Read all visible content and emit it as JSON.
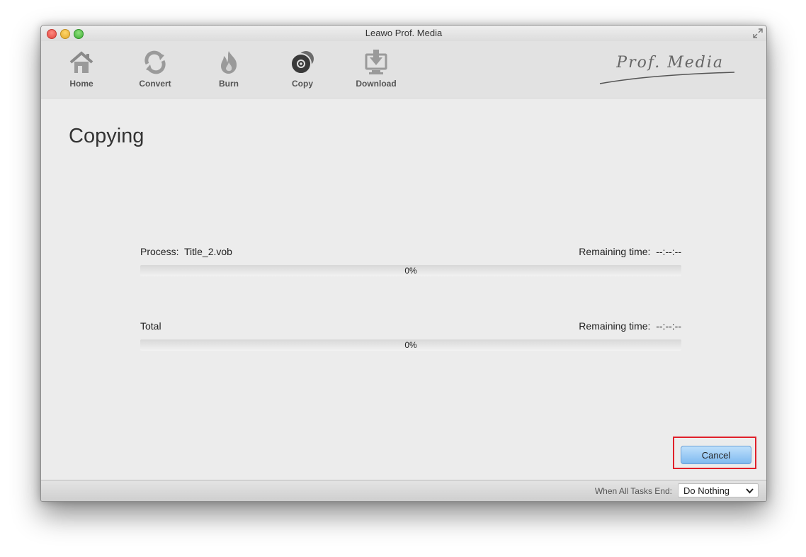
{
  "window": {
    "title": "Leawo Prof. Media"
  },
  "toolbar": {
    "items": [
      {
        "label": "Home",
        "icon": "home-icon"
      },
      {
        "label": "Convert",
        "icon": "convert-icon"
      },
      {
        "label": "Burn",
        "icon": "burn-icon"
      },
      {
        "label": "Copy",
        "icon": "copy-icon"
      },
      {
        "label": "Download",
        "icon": "download-icon"
      }
    ],
    "brand": "Prof. Media"
  },
  "main": {
    "title": "Copying",
    "process": {
      "label": "Process:",
      "file": "Title_2.vob",
      "remaining_label": "Remaining time:",
      "remaining_value": "--:--:--",
      "percent_text": "0%",
      "progress": 0
    },
    "total": {
      "label": "Total",
      "remaining_label": "Remaining time:",
      "remaining_value": "--:--:--",
      "percent_text": "0%",
      "progress": 0
    },
    "cancel_label": "Cancel"
  },
  "statusbar": {
    "when_label": "When All Tasks End:",
    "select_value": "Do Nothing"
  },
  "colors": {
    "highlight": "#e0202a",
    "button": "#7fbaf0"
  }
}
